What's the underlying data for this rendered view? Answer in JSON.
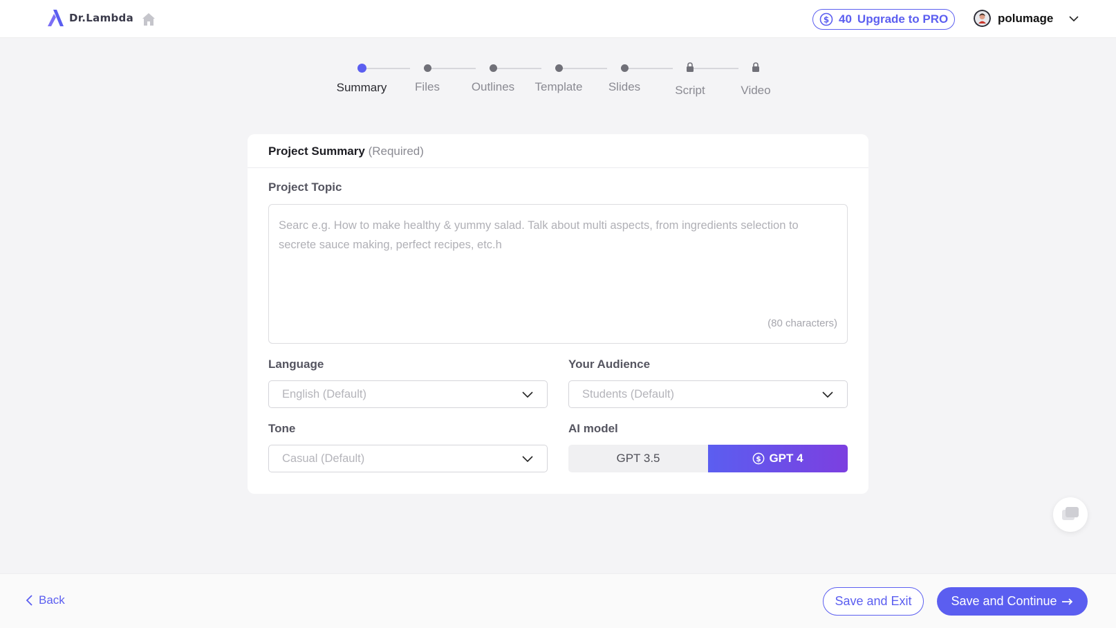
{
  "header": {
    "brand": "Dr.Lambda",
    "credits_count": "40",
    "upgrade_label": "Upgrade to PRO",
    "username": "polumage",
    "icons": {
      "logo": "lambda-logo-icon",
      "home": "home-icon",
      "coin": "dollar-coin-icon",
      "account_menu": "chevron-down-icon"
    }
  },
  "stepper": {
    "steps": [
      {
        "label": "Summary",
        "state": "active"
      },
      {
        "label": "Files",
        "state": "pending"
      },
      {
        "label": "Outlines",
        "state": "pending"
      },
      {
        "label": "Template",
        "state": "pending"
      },
      {
        "label": "Slides",
        "state": "pending"
      },
      {
        "label": "Script",
        "state": "locked"
      },
      {
        "label": "Video",
        "state": "locked"
      }
    ]
  },
  "form": {
    "section_title": "Project Summary",
    "section_note": "(Required)",
    "topic_label": "Project Topic",
    "topic_placeholder": "Searc e.g. How to make healthy & yummy salad. Talk about multi aspects, from ingredients selection to secrete sauce making, perfect recipes, etc.h",
    "topic_value": "",
    "char_limit": "(80 characters)",
    "language_label": "Language",
    "language_value": "English (Default)",
    "audience_label": "Your Audience",
    "audience_value": "Students (Default)",
    "tone_label": "Tone",
    "tone_value": "Casual (Default)",
    "model_label": "AI model",
    "model_options": [
      {
        "label": "GPT 3.5",
        "selected": false
      },
      {
        "label": "GPT 4",
        "selected": true,
        "premium": true
      }
    ]
  },
  "footer": {
    "back_label": "Back",
    "save_exit_label": "Save and Exit",
    "save_continue_label": "Save and Continue"
  },
  "colors": {
    "accent": "#5b5ef0",
    "gradient_end": "#7c3fe0",
    "background": "#f4f4f6",
    "card": "#ffffff"
  }
}
